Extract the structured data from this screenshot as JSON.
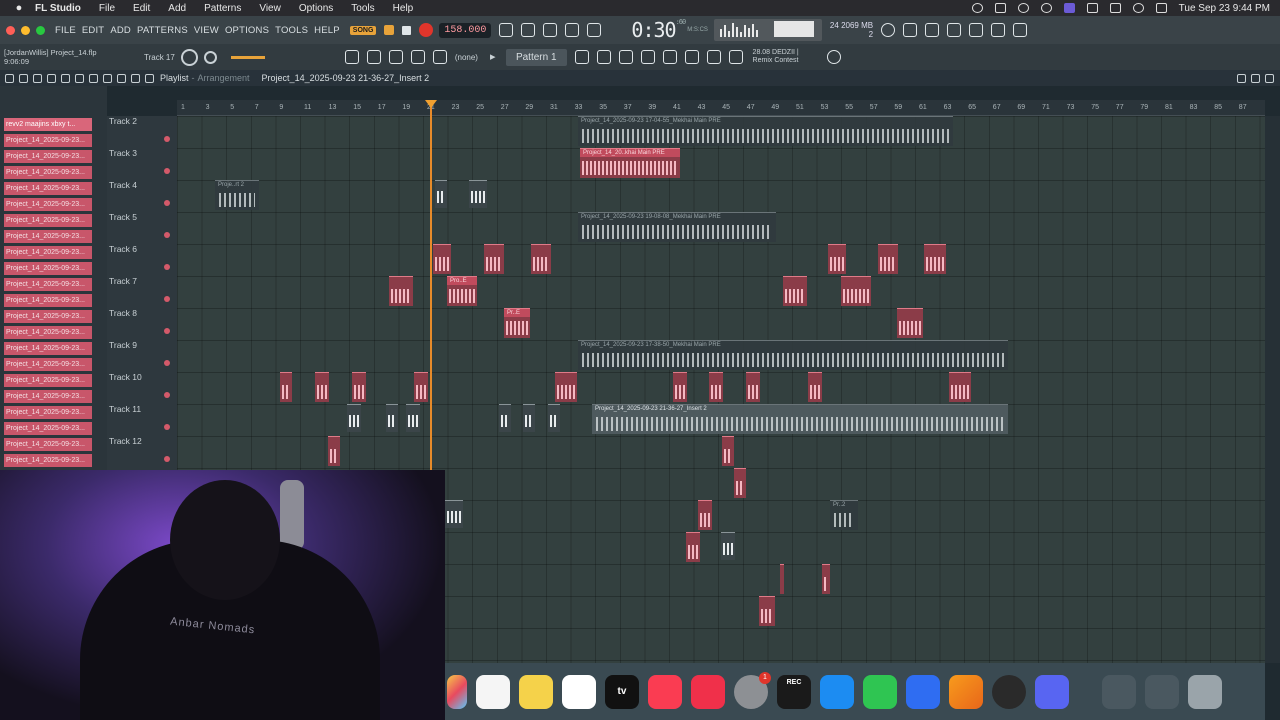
{
  "menubar": {
    "app": "FL Studio",
    "items": [
      "File",
      "Edit",
      "Add",
      "Patterns",
      "View",
      "Options",
      "Tools",
      "Help"
    ],
    "clock": "Tue Sep 23  9:44 PM"
  },
  "toolbar": {
    "menu": [
      "FILE",
      "EDIT",
      "ADD",
      "PATTERNS",
      "VIEW",
      "OPTIONS",
      "TOOLS",
      "HELP"
    ],
    "pat_song": "SONG",
    "tempo": "158.000",
    "time": "0:30",
    "time_frac": ":60",
    "time_unit": "M:S:CS",
    "cpu": "24",
    "mem": "2069 MB",
    "mem2": "2",
    "colors": {
      "accent": "#e8a33a",
      "record": "#e0352b",
      "clip": "#c8566a"
    }
  },
  "bar2": {
    "user": "[JordanWillis] Project_14.flp",
    "elapsed": "9:06:09",
    "track": "Track 17",
    "pattern": "Pattern 1",
    "snap": "(none)",
    "news1": "28.08  DEDZII |",
    "news2": "Remix Contest"
  },
  "playlist": {
    "title": "Playlist",
    "sep": " - ",
    "sub": "Arrangement",
    "arrangement": "Project_14_2025-09-23 21-36-27_Insert 2"
  },
  "channels": [
    "revv2 maajins xbxy t...",
    "Project_14_2025-09-23...",
    "Project_14_2025-09-23...",
    "Project_14_2025-09-23...",
    "Project_14_2025-09-23...",
    "Project_14_2025-09-23...",
    "Project_14_2025-09-23...",
    "Project_14_2025-09-23...",
    "Project_14_2025-09-23...",
    "Project_14_2025-09-23...",
    "Project_14_2025-09-23...",
    "Project_14_2025-09-23...",
    "Project_14_2025-09-23...",
    "Project_14_2025-09-23...",
    "Project_14_2025-09-23...",
    "Project_14_2025-09-23...",
    "Project_14_2025-09-23...",
    "Project_14_2025-09-23...",
    "Project_14_2025-09-23...",
    "Project_14_2025-09-23...",
    "Project_14_2025-09-23...",
    "Project_14_2025-09-23...",
    "Project_14_2025-09-23..."
  ],
  "tracks": [
    "Track 2",
    "Track 3",
    "Track 4",
    "Track 5",
    "Track 6",
    "Track 7",
    "Track 8",
    "Track 9",
    "Track 10",
    "Track 11",
    "Track 12"
  ],
  "ruler": [
    "1",
    "3",
    "5",
    "7",
    "9",
    "11",
    "13",
    "15",
    "17",
    "19",
    "21",
    "23",
    "25",
    "27",
    "29",
    "31",
    "33",
    "35",
    "37",
    "39",
    "41",
    "43",
    "45",
    "47",
    "49",
    "51",
    "53",
    "55",
    "57",
    "59",
    "61",
    "63",
    "65",
    "67",
    "69",
    "71",
    "73",
    "75",
    "77",
    "79",
    "81",
    "83",
    "85",
    "87"
  ],
  "clips": {
    "t2": "Project_14_2025-09-23 17-04-55_Mekhai Main PRE",
    "t3": "Project_14_20..khai Main PRE",
    "t4": "Proje..rt 2",
    "t5": "Project_14_2025-09-23 19-08-08_Mekhai Main PRE",
    "t7": "Pro..E",
    "t8": "Pr..E",
    "t9": "Project_14_2025-09-23 17-38-50_Mekhai Main PRE",
    "t11": "Project_14_2025-09-23 21-36-27_Insert 2",
    "low": "Pr..2"
  },
  "webcam": {
    "shirt_text": "Anbar Nomads"
  },
  "dock": {
    "apps": [
      "photos-icon",
      "reminders-icon",
      "notes-icon",
      "freeform-icon",
      "apple-tv-icon",
      "music-icon",
      "news-icon",
      "system-settings-icon",
      "rec-icon",
      "app-store-icon",
      "numbers-icon",
      "preview-icon",
      "fl-studio-icon",
      "obs-icon",
      "discord-icon",
      "downloads-icon",
      "screens-icon",
      "trash-icon"
    ],
    "settings_badge": "1",
    "tv_label": "tv",
    "rec_label": "REC"
  }
}
